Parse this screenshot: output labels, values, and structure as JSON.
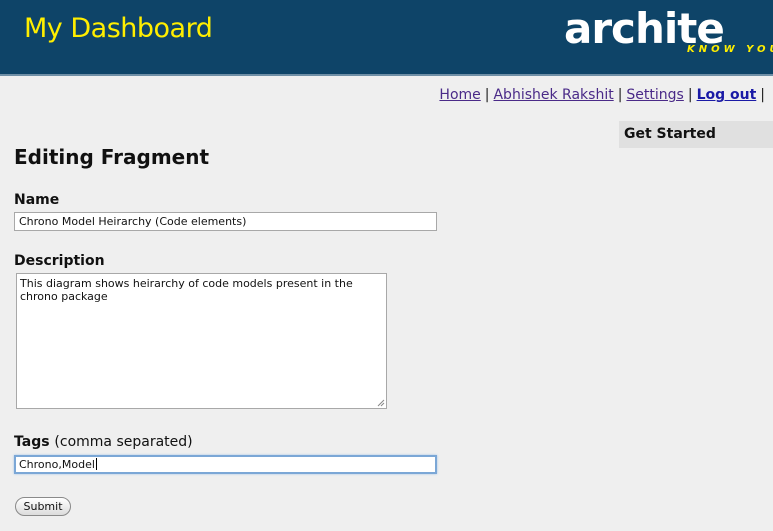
{
  "header": {
    "app_title": "My Dashboard",
    "logo": {
      "word": "archite",
      "tagline": "KNOW YOU"
    },
    "colors": {
      "background": "#0e4468",
      "title": "#ffee00",
      "logo_word": "#ffffff",
      "logo_tagline": "#ffee00"
    }
  },
  "nav": {
    "items": [
      {
        "label": "Home"
      },
      {
        "label": "Abhishek Rakshit"
      },
      {
        "label": "Settings"
      },
      {
        "label": "Log out"
      }
    ],
    "separator": "|"
  },
  "sidebar": {
    "title": "Get Started"
  },
  "form": {
    "heading": "Editing Fragment",
    "name_label": "Name",
    "name_value": "Chrono Model Heirarchy (Code elements)",
    "description_label": "Description",
    "description_value": "This diagram shows heirarchy of code models present in the chrono package",
    "tags_label": "Tags",
    "tags_hint": "(comma separated)",
    "tags_value": "Chrono,Model",
    "submit_label": "Submit"
  }
}
